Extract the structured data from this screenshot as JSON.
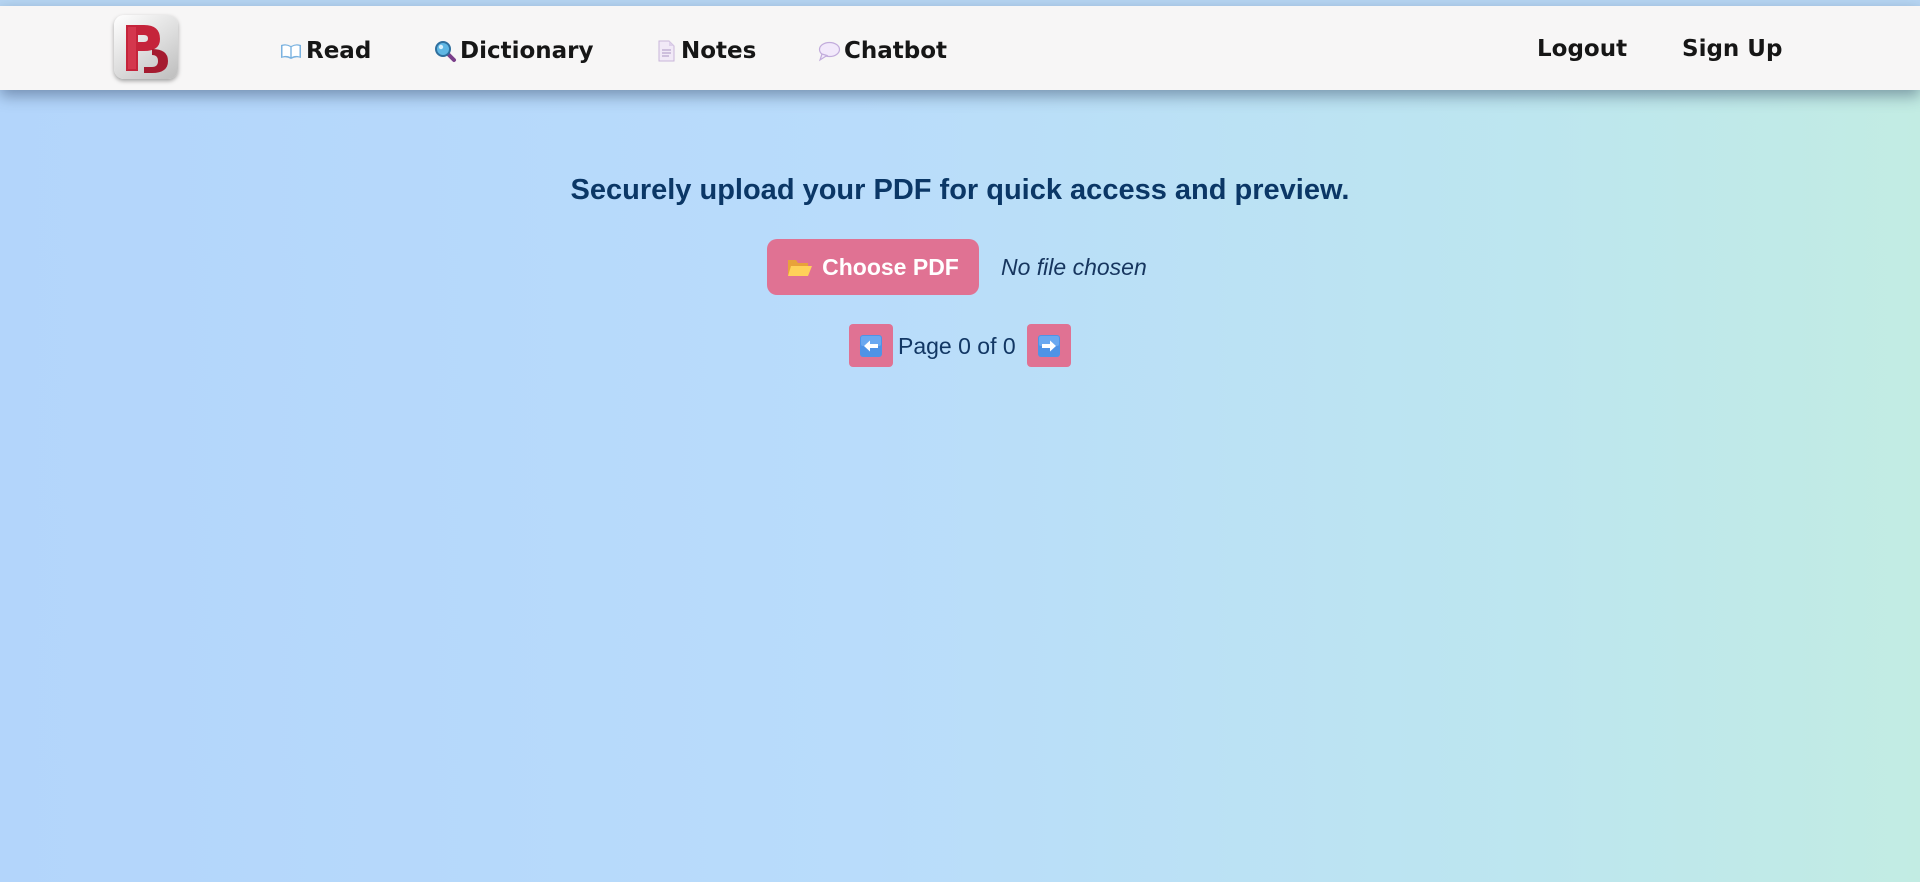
{
  "nav": {
    "links": [
      {
        "label": "Read",
        "icon": "open-book-icon"
      },
      {
        "label": "Dictionary",
        "icon": "magnifier-icon"
      },
      {
        "label": "Notes",
        "icon": "page-icon"
      },
      {
        "label": "Chatbot",
        "icon": "speech-balloon-icon"
      }
    ],
    "logout_label": "Logout",
    "signup_label": "Sign Up"
  },
  "main": {
    "heading": "Securely upload your PDF for quick access and preview.",
    "choose_button": {
      "label": "Choose PDF",
      "icon": "folder-icon"
    },
    "file_status": "No file chosen",
    "pager": {
      "text": "Page 0 of 0",
      "prev_icon": "left-arrow-icon",
      "next_icon": "right-arrow-icon"
    }
  },
  "colors": {
    "button": "#e07293",
    "heading": "#0b3766",
    "navbar": "#f7f6f6"
  }
}
